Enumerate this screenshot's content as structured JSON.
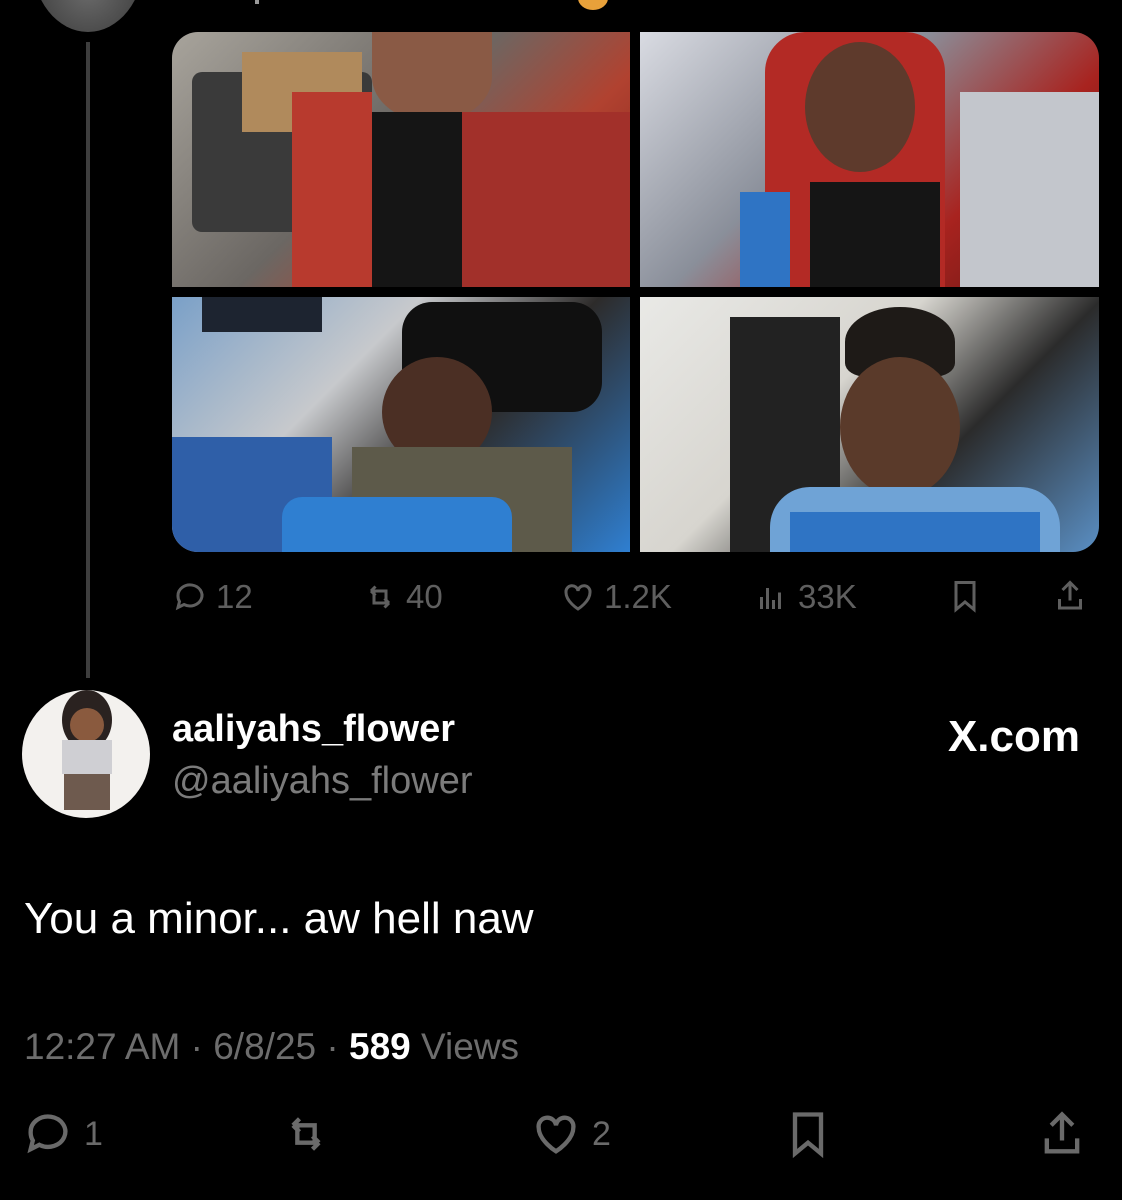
{
  "top_tweet": {
    "stats": {
      "replies": "12",
      "reposts": "40",
      "likes": "1.2K",
      "views": "33K"
    },
    "media": [
      {
        "icon": "photo"
      },
      {
        "icon": "photo"
      },
      {
        "icon": "photo"
      },
      {
        "icon": "photo"
      }
    ]
  },
  "reply": {
    "display_name": "aaliyahs_flower",
    "handle": "@aaliyahs_flower",
    "watermark": "X.com",
    "text": "You a minor... aw hell naw",
    "time": "12:27 AM",
    "date": "6/8/25",
    "views_count": "589",
    "views_label": "Views",
    "stats": {
      "replies": "1",
      "reposts": "",
      "likes": "2"
    }
  },
  "colors": {
    "background": "#000000",
    "muted": "#6a6a6a",
    "text": "#ffffff"
  }
}
